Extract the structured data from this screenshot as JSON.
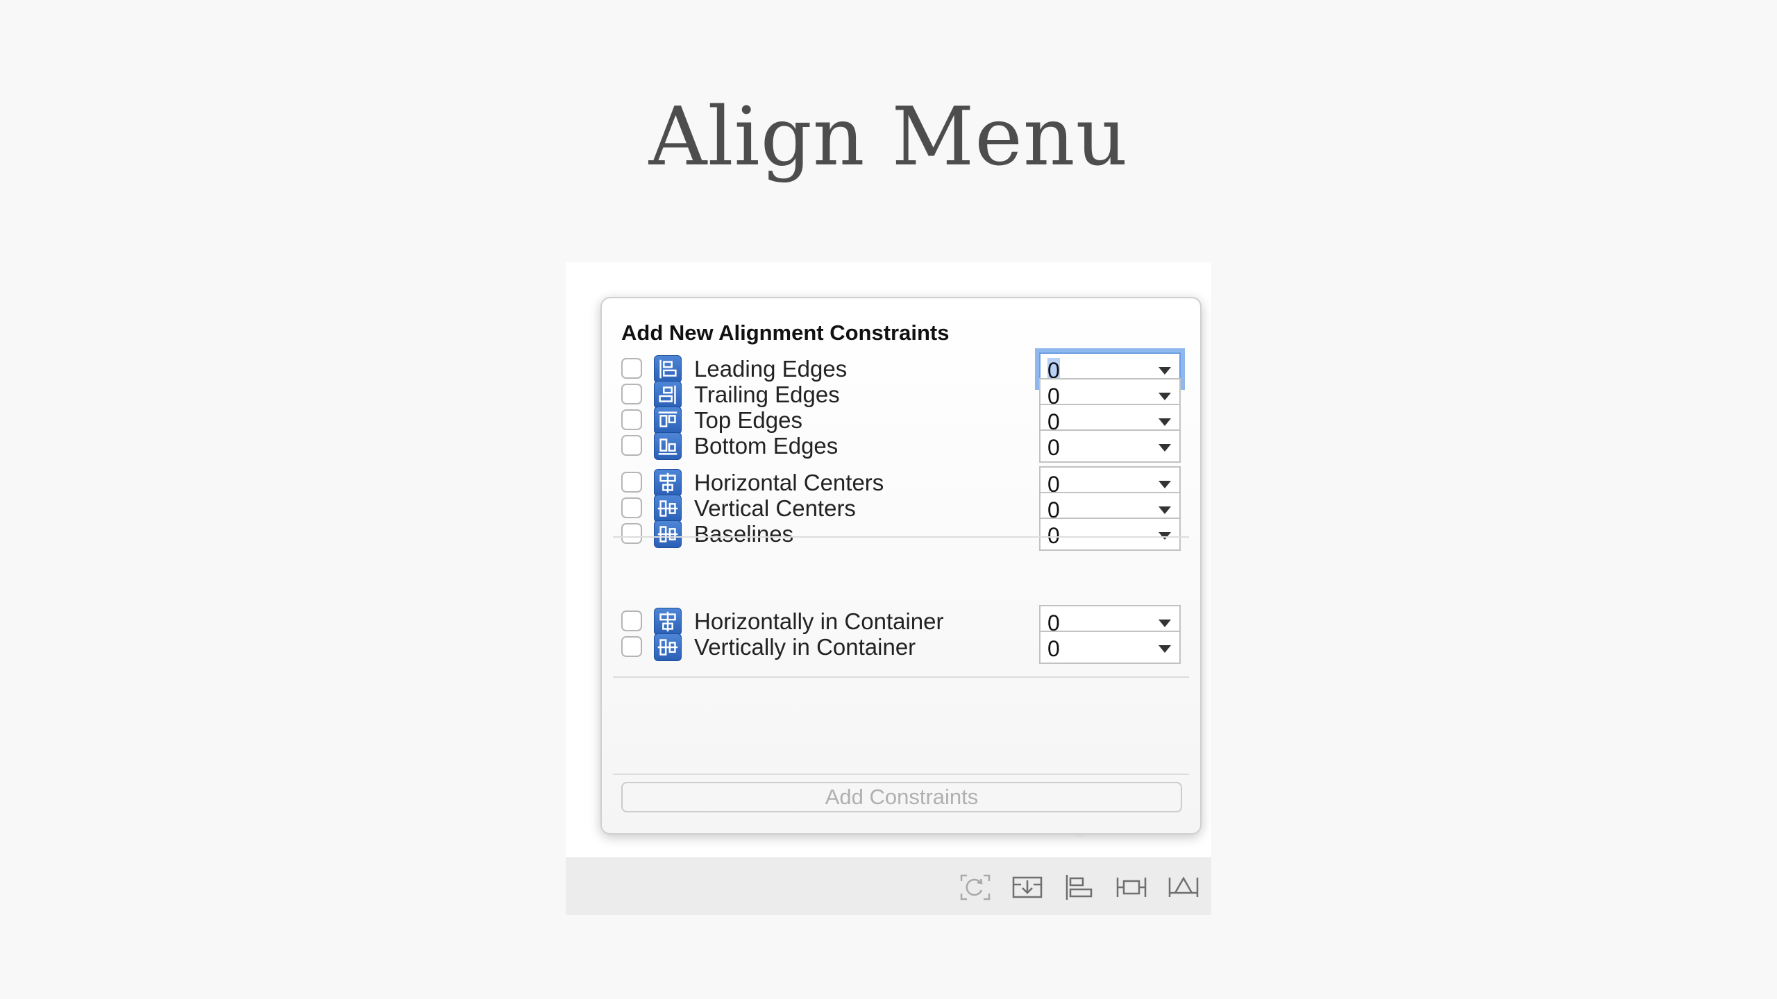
{
  "slide": {
    "title": "Align Menu"
  },
  "popover": {
    "title": "Add New Alignment Constraints",
    "groups": [
      [
        {
          "label": "Leading Edges",
          "icon": "leading-edges-icon",
          "value": "0",
          "checked": false,
          "focused": true
        },
        {
          "label": "Trailing Edges",
          "icon": "trailing-edges-icon",
          "value": "0",
          "checked": false
        },
        {
          "label": "Top Edges",
          "icon": "top-edges-icon",
          "value": "0",
          "checked": false
        },
        {
          "label": "Bottom Edges",
          "icon": "bottom-edges-icon",
          "value": "0",
          "checked": false
        }
      ],
      [
        {
          "label": "Horizontal Centers",
          "icon": "horizontal-centers-icon",
          "value": "0",
          "checked": false
        },
        {
          "label": "Vertical Centers",
          "icon": "vertical-centers-icon",
          "value": "0",
          "checked": false
        },
        {
          "label": "Baselines",
          "icon": "baselines-icon",
          "value": "0",
          "checked": false
        }
      ],
      [
        {
          "label": "Horizontally in Container",
          "icon": "horizontally-in-container-icon",
          "value": "0",
          "checked": false
        },
        {
          "label": "Vertically in Container",
          "icon": "vertically-in-container-icon",
          "value": "0",
          "checked": false
        }
      ]
    ],
    "add_button": {
      "label": "Add Constraints",
      "enabled": false
    }
  },
  "toolbar": {
    "buttons": [
      {
        "icon": "update-frames-icon"
      },
      {
        "icon": "embed-in-stack-icon"
      },
      {
        "icon": "align-icon",
        "active": true
      },
      {
        "icon": "pin-icon"
      },
      {
        "icon": "resolve-auto-layout-issues-icon"
      }
    ]
  },
  "colors": {
    "background": "#f8f8f8",
    "title_text": "#4d4d4d",
    "icon_blue": "#2a5fb6",
    "focus_ring": "#8fb8ee",
    "disabled_text": "#b0b0b0",
    "toolbar_bg": "#ececec"
  }
}
